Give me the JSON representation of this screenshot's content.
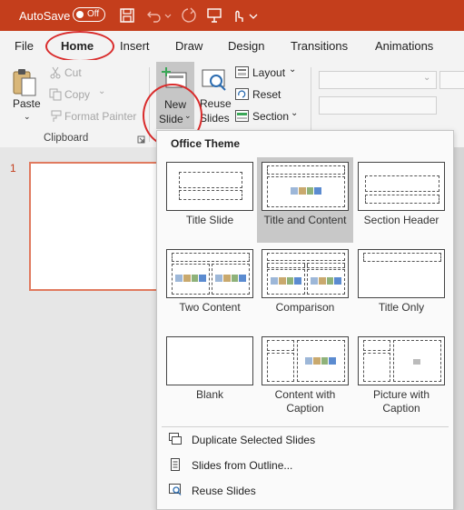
{
  "titlebar": {
    "autosave_label": "AutoSave",
    "toggle_state": "Off",
    "icons": [
      "save-icon",
      "undo-icon",
      "redo-icon",
      "present-icon",
      "touch-icon",
      "customize-icon"
    ]
  },
  "tabs": [
    "File",
    "Home",
    "Insert",
    "Draw",
    "Design",
    "Transitions",
    "Animations"
  ],
  "active_tab": "Home",
  "ribbon": {
    "clipboard": {
      "paste": "Paste",
      "cut": "Cut",
      "copy": "Copy",
      "format_painter": "Format Painter",
      "group_label": "Clipboard"
    },
    "slides": {
      "new_slide_line1": "New",
      "new_slide_line2": "Slide",
      "reuse_line1": "Reuse",
      "reuse_line2": "Slides",
      "layout": "Layout",
      "reset": "Reset",
      "section": "Section"
    }
  },
  "slide_panel": {
    "number": "1"
  },
  "dropdown": {
    "title": "Office Theme",
    "layouts": [
      {
        "name": "Title Slide"
      },
      {
        "name": "Title and Content",
        "selected": true
      },
      {
        "name": "Section Header"
      },
      {
        "name": "Two Content"
      },
      {
        "name": "Comparison"
      },
      {
        "name": "Title Only"
      },
      {
        "name": "Blank"
      },
      {
        "name": "Content with Caption"
      },
      {
        "name": "Picture with Caption"
      }
    ],
    "commands": {
      "duplicate": "Duplicate Selected Slides",
      "outline": "Slides from Outline...",
      "reuse": "Reuse Slides"
    }
  },
  "colors": {
    "brand": "#c43e1c",
    "annotation": "#d92b2b"
  }
}
